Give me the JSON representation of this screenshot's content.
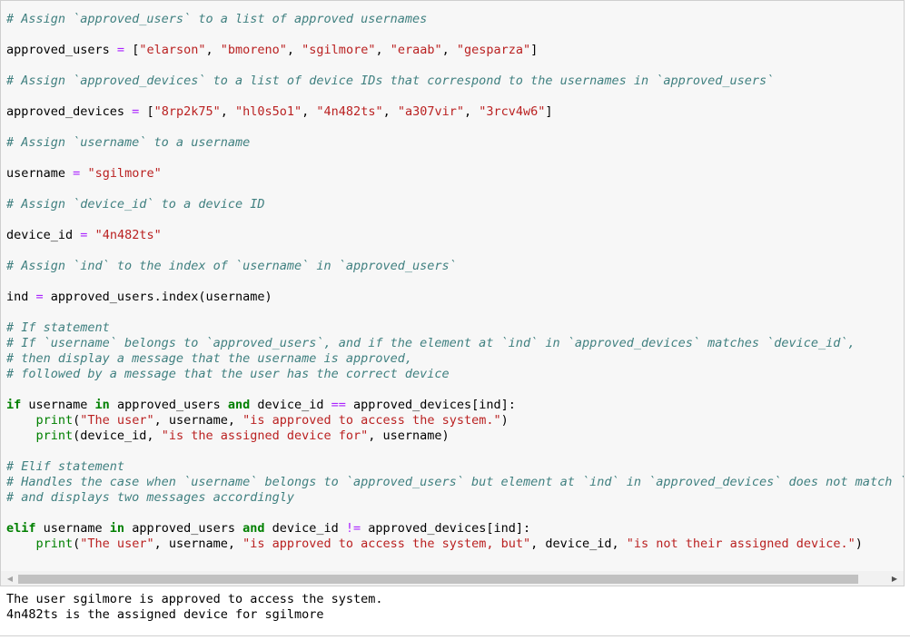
{
  "code_lines": [
    [
      {
        "t": "# Assign `approved_users` to a list of approved usernames",
        "c": "comment"
      }
    ],
    [
      {
        "t": "approved_users ",
        "c": "plain"
      },
      {
        "t": "=",
        "c": "op"
      },
      {
        "t": " [",
        "c": "plain"
      },
      {
        "t": "\"elarson\"",
        "c": "string"
      },
      {
        "t": ", ",
        "c": "plain"
      },
      {
        "t": "\"bmoreno\"",
        "c": "string"
      },
      {
        "t": ", ",
        "c": "plain"
      },
      {
        "t": "\"sgilmore\"",
        "c": "string"
      },
      {
        "t": ", ",
        "c": "plain"
      },
      {
        "t": "\"eraab\"",
        "c": "string"
      },
      {
        "t": ", ",
        "c": "plain"
      },
      {
        "t": "\"gesparza\"",
        "c": "string"
      },
      {
        "t": "]",
        "c": "plain"
      }
    ],
    [
      {
        "t": "# Assign `approved_devices` to a list of device IDs that correspond to the usernames in `approved_users`",
        "c": "comment"
      }
    ],
    [
      {
        "t": "approved_devices ",
        "c": "plain"
      },
      {
        "t": "=",
        "c": "op"
      },
      {
        "t": " [",
        "c": "plain"
      },
      {
        "t": "\"8rp2k75\"",
        "c": "string"
      },
      {
        "t": ", ",
        "c": "plain"
      },
      {
        "t": "\"hl0s5o1\"",
        "c": "string"
      },
      {
        "t": ", ",
        "c": "plain"
      },
      {
        "t": "\"4n482ts\"",
        "c": "string"
      },
      {
        "t": ", ",
        "c": "plain"
      },
      {
        "t": "\"a307vir\"",
        "c": "string"
      },
      {
        "t": ", ",
        "c": "plain"
      },
      {
        "t": "\"3rcv4w6\"",
        "c": "string"
      },
      {
        "t": "]",
        "c": "plain"
      }
    ],
    [
      {
        "t": "# Assign `username` to a username",
        "c": "comment"
      }
    ],
    [
      {
        "t": "username ",
        "c": "plain"
      },
      {
        "t": "=",
        "c": "op"
      },
      {
        "t": " ",
        "c": "plain"
      },
      {
        "t": "\"sgilmore\"",
        "c": "string"
      }
    ],
    [
      {
        "t": "# Assign `device_id` to a device ID",
        "c": "comment"
      }
    ],
    [
      {
        "t": "device_id ",
        "c": "plain"
      },
      {
        "t": "=",
        "c": "op"
      },
      {
        "t": " ",
        "c": "plain"
      },
      {
        "t": "\"4n482ts\"",
        "c": "string"
      }
    ],
    [
      {
        "t": "# Assign `ind` to the index of `username` in `approved_users`",
        "c": "comment"
      }
    ],
    [
      {
        "t": "ind ",
        "c": "plain"
      },
      {
        "t": "=",
        "c": "op"
      },
      {
        "t": " approved_users.index(username)",
        "c": "plain"
      }
    ],
    [
      {
        "t": "# If statement",
        "c": "comment"
      }
    ],
    [
      {
        "t": "# If `username` belongs to `approved_users`, and if the element at `ind` in `approved_devices` matches `device_id`,",
        "c": "comment"
      }
    ],
    [
      {
        "t": "# then display a message that the username is approved,",
        "c": "comment"
      }
    ],
    [
      {
        "t": "# followed by a message that the user has the correct device",
        "c": "comment"
      }
    ],
    [
      {
        "t": "if",
        "c": "kw"
      },
      {
        "t": " username ",
        "c": "plain"
      },
      {
        "t": "in",
        "c": "kw"
      },
      {
        "t": " approved_users ",
        "c": "plain"
      },
      {
        "t": "and",
        "c": "kw"
      },
      {
        "t": " device_id ",
        "c": "plain"
      },
      {
        "t": "==",
        "c": "op"
      },
      {
        "t": " approved_devices[ind]:",
        "c": "plain"
      }
    ],
    [
      {
        "t": "    ",
        "c": "plain"
      },
      {
        "t": "print",
        "c": "builtin"
      },
      {
        "t": "(",
        "c": "plain"
      },
      {
        "t": "\"The user\"",
        "c": "string"
      },
      {
        "t": ", username, ",
        "c": "plain"
      },
      {
        "t": "\"is approved to access the system.\"",
        "c": "string"
      },
      {
        "t": ")",
        "c": "plain"
      }
    ],
    [
      {
        "t": "    ",
        "c": "plain"
      },
      {
        "t": "print",
        "c": "builtin"
      },
      {
        "t": "(device_id, ",
        "c": "plain"
      },
      {
        "t": "\"is the assigned device for\"",
        "c": "string"
      },
      {
        "t": ", username)",
        "c": "plain"
      }
    ],
    [
      {
        "t": "# Elif statement",
        "c": "comment"
      }
    ],
    [
      {
        "t": "# Handles the case when `username` belongs to `approved_users` but element at `ind` in `approved_devices` does not match `device_",
        "c": "comment"
      }
    ],
    [
      {
        "t": "# and displays two messages accordingly",
        "c": "comment"
      }
    ],
    [
      {
        "t": "elif",
        "c": "kw"
      },
      {
        "t": " username ",
        "c": "plain"
      },
      {
        "t": "in",
        "c": "kw"
      },
      {
        "t": " approved_users ",
        "c": "plain"
      },
      {
        "t": "and",
        "c": "kw"
      },
      {
        "t": " device_id ",
        "c": "plain"
      },
      {
        "t": "!=",
        "c": "op"
      },
      {
        "t": " approved_devices[ind]:",
        "c": "plain"
      }
    ],
    [
      {
        "t": "    ",
        "c": "plain"
      },
      {
        "t": "print",
        "c": "builtin"
      },
      {
        "t": "(",
        "c": "plain"
      },
      {
        "t": "\"The user\"",
        "c": "string"
      },
      {
        "t": ", username, ",
        "c": "plain"
      },
      {
        "t": "\"is approved to access the system, but\"",
        "c": "string"
      },
      {
        "t": ", device_id, ",
        "c": "plain"
      },
      {
        "t": "\"is not their assigned device.\"",
        "c": "string"
      },
      {
        "t": ")",
        "c": "plain"
      }
    ]
  ],
  "scrollbar": {
    "left_arrow_icon": "triangle-left",
    "right_arrow_icon": "triangle-right"
  },
  "output": {
    "lines": [
      "The user sgilmore is approved to access the system.",
      "4n482ts is the assigned device for sgilmore"
    ]
  },
  "colors": {
    "comment": "#408080",
    "string": "#ba2121",
    "operator": "#aa22ff",
    "keyword": "#008000",
    "cell_background": "#f7f7f7"
  }
}
